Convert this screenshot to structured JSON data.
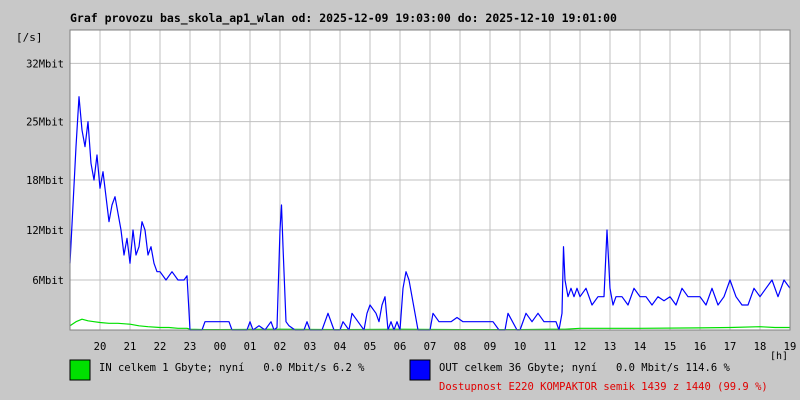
{
  "colors": {
    "background": "#c8c8c8",
    "plot_background": "#ffffff",
    "grid": "#c0c0c0",
    "in_series": "#00e000",
    "out_series": "#0000ff",
    "availability_text": "#e00000",
    "text": "#000000"
  },
  "chart_data": {
    "type": "line",
    "title": "Graf provozu bas_skola_ap1_wlan od: 2025-12-09 19:03:00 do: 2025-12-10 19:01:00",
    "ylabel": "[/s]",
    "xlabel": "[h]",
    "ylim": [
      0,
      36
    ],
    "xlim": [
      19,
      43
    ],
    "grid": true,
    "y_ticks": [
      {
        "value": 6,
        "label": "6Mbit"
      },
      {
        "value": 12,
        "label": "12Mbit"
      },
      {
        "value": 18,
        "label": "18Mbit"
      },
      {
        "value": 25,
        "label": "25Mbit"
      },
      {
        "value": 32,
        "label": "32Mbit"
      }
    ],
    "x_ticks": [
      {
        "value": 20,
        "label": "20"
      },
      {
        "value": 21,
        "label": "21"
      },
      {
        "value": 22,
        "label": "22"
      },
      {
        "value": 23,
        "label": "23"
      },
      {
        "value": 24,
        "label": "00"
      },
      {
        "value": 25,
        "label": "01"
      },
      {
        "value": 26,
        "label": "02"
      },
      {
        "value": 27,
        "label": "03"
      },
      {
        "value": 28,
        "label": "04"
      },
      {
        "value": 29,
        "label": "05"
      },
      {
        "value": 30,
        "label": "06"
      },
      {
        "value": 31,
        "label": "07"
      },
      {
        "value": 32,
        "label": "08"
      },
      {
        "value": 33,
        "label": "09"
      },
      {
        "value": 34,
        "label": "10"
      },
      {
        "value": 35,
        "label": "11"
      },
      {
        "value": 36,
        "label": "12"
      },
      {
        "value": 37,
        "label": "13"
      },
      {
        "value": 38,
        "label": "14"
      },
      {
        "value": 39,
        "label": "15"
      },
      {
        "value": 40,
        "label": "16"
      },
      {
        "value": 41,
        "label": "17"
      },
      {
        "value": 42,
        "label": "18"
      },
      {
        "value": 43,
        "label": "19"
      }
    ],
    "series": [
      {
        "name": "IN",
        "color": "#00e000",
        "x": [
          19.0,
          19.2,
          19.4,
          19.6,
          19.8,
          20.0,
          20.3,
          20.6,
          21.0,
          21.3,
          21.6,
          22.0,
          22.3,
          22.6,
          22.9,
          23.0,
          23.5,
          24.0,
          26.0,
          28.0,
          30.0,
          32.0,
          34.0,
          35.0,
          35.5,
          36.0,
          38.0,
          40.0,
          41.0,
          42.0,
          42.5,
          43.0
        ],
        "values": [
          0.5,
          1.0,
          1.3,
          1.1,
          1.0,
          0.9,
          0.8,
          0.8,
          0.7,
          0.5,
          0.4,
          0.3,
          0.3,
          0.2,
          0.2,
          0.1,
          0.05,
          0.05,
          0.1,
          0.05,
          0.1,
          0.05,
          0.05,
          0.1,
          0.1,
          0.2,
          0.2,
          0.25,
          0.3,
          0.4,
          0.3,
          0.3
        ]
      },
      {
        "name": "OUT",
        "color": "#0000ff",
        "x": [
          19.0,
          19.1,
          19.2,
          19.3,
          19.4,
          19.5,
          19.6,
          19.7,
          19.8,
          19.9,
          20.0,
          20.1,
          20.2,
          20.3,
          20.4,
          20.5,
          20.6,
          20.7,
          20.8,
          20.9,
          21.0,
          21.1,
          21.2,
          21.3,
          21.4,
          21.5,
          21.6,
          21.7,
          21.8,
          21.9,
          22.0,
          22.2,
          22.4,
          22.6,
          22.8,
          22.9,
          23.0,
          23.4,
          23.5,
          24.3,
          24.4,
          24.9,
          25.0,
          25.1,
          25.3,
          25.5,
          25.7,
          25.8,
          25.9,
          26.0,
          26.05,
          26.1,
          26.2,
          26.3,
          26.5,
          26.8,
          26.9,
          27.0,
          27.4,
          27.5,
          27.6,
          27.8,
          28.0,
          28.1,
          28.3,
          28.4,
          28.6,
          28.8,
          28.9,
          29.0,
          29.2,
          29.3,
          29.4,
          29.5,
          29.6,
          29.7,
          29.8,
          29.9,
          30.0,
          30.1,
          30.2,
          30.3,
          30.4,
          30.5,
          30.6,
          30.8,
          31.0,
          31.1,
          31.3,
          31.5,
          31.7,
          31.9,
          32.1,
          32.3,
          32.5,
          32.7,
          32.9,
          33.0,
          33.1,
          33.3,
          33.5,
          33.6,
          33.9,
          34.0,
          34.2,
          34.4,
          34.6,
          34.8,
          35.0,
          35.2,
          35.3,
          35.4,
          35.45,
          35.5,
          35.6,
          35.7,
          35.8,
          35.9,
          36.0,
          36.2,
          36.4,
          36.6,
          36.8,
          36.9,
          37.0,
          37.1,
          37.2,
          37.4,
          37.6,
          37.8,
          38.0,
          38.2,
          38.4,
          38.6,
          38.8,
          39.0,
          39.2,
          39.4,
          39.6,
          39.8,
          40.0,
          40.2,
          40.4,
          40.6,
          40.8,
          41.0,
          41.2,
          41.4,
          41.6,
          41.8,
          42.0,
          42.2,
          42.4,
          42.6,
          42.8,
          43.0
        ],
        "values": [
          8,
          15,
          22,
          28,
          24,
          22,
          25,
          20,
          18,
          21,
          17,
          19,
          16,
          13,
          15,
          16,
          14,
          12,
          9,
          11,
          8,
          12,
          9,
          10,
          13,
          12,
          9,
          10,
          8,
          7,
          7,
          6,
          7,
          6,
          6,
          6.5,
          0,
          0,
          1,
          1,
          0,
          0,
          1,
          0,
          0.5,
          0,
          1,
          0,
          0.3,
          12,
          15,
          10,
          1,
          0.5,
          0,
          0,
          1,
          0,
          0,
          1,
          2,
          0,
          0,
          1,
          0,
          2,
          1,
          0,
          2,
          3,
          2,
          1,
          3,
          4,
          0,
          1,
          0,
          1,
          0,
          5,
          7,
          6,
          4,
          2,
          0,
          0,
          0,
          2,
          1,
          1,
          1,
          1.5,
          1,
          1,
          1,
          1,
          1,
          1,
          1,
          0,
          0,
          2,
          0,
          0,
          2,
          1,
          2,
          1,
          1,
          1,
          0,
          2,
          10,
          6,
          4,
          5,
          4,
          5,
          4,
          5,
          3,
          4,
          4,
          12,
          5,
          3,
          4,
          4,
          3,
          5,
          4,
          4,
          3,
          4,
          3.5,
          4,
          3,
          5,
          4,
          4,
          4,
          3,
          5,
          3,
          4,
          6,
          4,
          3,
          3,
          5,
          4,
          5,
          6,
          4,
          6,
          5
        ]
      }
    ]
  },
  "legend": {
    "in_text": "IN celkem 1 Gbyte; nyní   0.0 Mbit/s 6.2 %",
    "out_text": "OUT celkem 36 Gbyte; nyní   0.0 Mbit/s 114.6 %",
    "availability_text": "Dostupnost E220 KOMPAKTOR semik 1439 z 1440 (99.9 %)"
  }
}
